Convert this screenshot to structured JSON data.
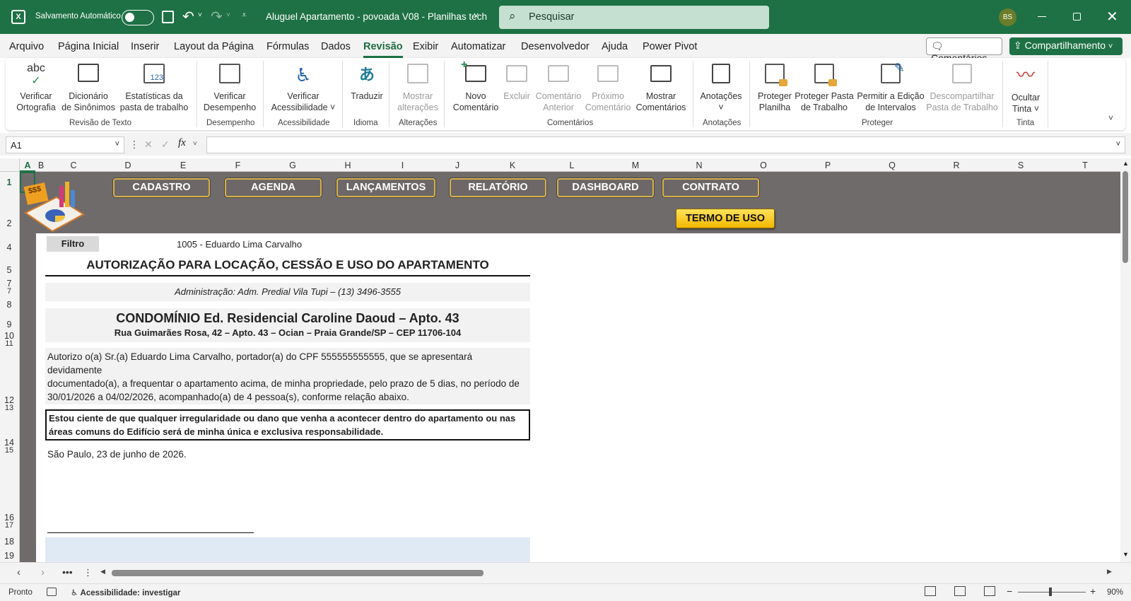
{
  "titlebar": {
    "autosave_label": "Salvamento Automático",
    "file_title": "Aluguel Apartamento - povoada V08 - Planilhas tech",
    "search_placeholder": "Pesquisar",
    "user_initials": "BS"
  },
  "menu": [
    "Arquivo",
    "Página Inicial",
    "Inserir",
    "Layout da Página",
    "Fórmulas",
    "Dados",
    "Revisão",
    "Exibir",
    "Automatizar",
    "Desenvolvedor",
    "Ajuda",
    "Power Pivot"
  ],
  "menu_active": "Revisão",
  "header_buttons": {
    "comments": "Comentários",
    "share": "Compartilhamento"
  },
  "ribbon": {
    "buttons": [
      {
        "l1": "Verificar",
        "l2": "Ortografia",
        "icon": "spelling-icon"
      },
      {
        "l1": "Dicionário",
        "l2": "de Sinônimos",
        "icon": "thesaurus-icon"
      },
      {
        "l1": "Estatísticas da",
        "l2": "pasta de trabalho",
        "icon": "workbook-stats-icon"
      },
      {
        "l1": "Verificar",
        "l2": "Desempenho",
        "icon": "performance-icon"
      },
      {
        "l1": "Verificar",
        "l2": "Acessibilidade ˅",
        "icon": "accessibility-icon"
      },
      {
        "l1": "Traduzir",
        "l2": "",
        "icon": "translate-icon"
      },
      {
        "l1": "Mostrar",
        "l2": "alterações",
        "icon": "show-changes-icon"
      },
      {
        "l1": "Novo",
        "l2": "Comentário",
        "icon": "new-comment-icon"
      },
      {
        "l1": "Excluir",
        "l2": "",
        "icon": "delete-comment-icon"
      },
      {
        "l1": "Comentário",
        "l2": "Anterior",
        "icon": "previous-comment-icon"
      },
      {
        "l1": "Próximo",
        "l2": "Comentário",
        "icon": "next-comment-icon"
      },
      {
        "l1": "Mostrar",
        "l2": "Comentários",
        "icon": "show-comments-icon"
      },
      {
        "l1": "Anotações",
        "l2": "˅",
        "icon": "notes-icon"
      },
      {
        "l1": "Proteger",
        "l2": "Planilha",
        "icon": "protect-sheet-icon"
      },
      {
        "l1": "Proteger Pasta",
        "l2": "de Trabalho",
        "icon": "protect-workbook-icon"
      },
      {
        "l1": "Permitir a Edição",
        "l2": "de Intervalos",
        "icon": "allow-edit-ranges-icon"
      },
      {
        "l1": "Descompartilhar",
        "l2": "Pasta de Trabalho",
        "icon": "unshare-workbook-icon"
      },
      {
        "l1": "Ocultar",
        "l2": "Tinta ˅",
        "icon": "hide-ink-icon"
      }
    ],
    "groups": [
      "Revisão de Texto",
      "Desempenho",
      "Acessibilidade",
      "Idioma",
      "Alterações",
      "Comentários",
      "Anotações",
      "Proteger",
      "Tinta"
    ]
  },
  "formula_bar": {
    "name_box": "A1",
    "fx": "fx"
  },
  "columns": [
    "A",
    "B",
    "C",
    "D",
    "E",
    "F",
    "G",
    "H",
    "I",
    "J",
    "K",
    "L",
    "M",
    "N",
    "O",
    "P",
    "Q",
    "R",
    "S",
    "T"
  ],
  "rows": [
    "1",
    "2",
    "4",
    "5",
    "7",
    "8",
    "9",
    "10",
    "11",
    "12",
    "13",
    "14",
    "15",
    "16",
    "17",
    "18",
    "19"
  ],
  "nav": {
    "buttons": [
      "CADASTRO",
      "AGENDA",
      "LANÇAMENTOS",
      "RELATÓRIO",
      "DASHBOARD",
      "CONTRATO"
    ],
    "termo": "TERMO DE USO",
    "logo_text": "$$$"
  },
  "doc": {
    "filtro_label": "Filtro",
    "filtro_value": "1005 - Eduardo Lima Carvalho",
    "title": "AUTORIZAÇÃO PARA LOCAÇÃO, CESSÃO E USO DO APARTAMENTO",
    "admin": "Administração: Adm. Predial Vila Tupi – (13) 3496-3555",
    "condo": "CONDOMÍNIO Ed. Residencial Caroline Daoud – Apto. 43",
    "address": "Rua Guimarães Rosa, 42 – Apto. 43 – Ocian – Praia Grande/SP – CEP 11706-104",
    "body_l1": "Autorizo o(a) Sr.(a) Eduardo Lima Carvalho, portador(a) do CPF 555555555555, que se apresentará devidamente",
    "body_l2": "documentado(a), a frequentar o apartamento acima, de minha propriedade, pelo prazo de 5 dias, no período de",
    "body_l3": "30/01/2026 a 04/02/2026, acompanhado(a) de 4 pessoa(s), conforme relação abaixo.",
    "notice_l1": "Estou ciente de que qualquer irregularidade ou dano que venha a acontecer dentro do apartamento ou nas",
    "notice_l2": "áreas comuns do Edifício será de minha única e exclusiva responsabilidade.",
    "date": "São Paulo, 23 de junho de 2026."
  },
  "status": {
    "ready": "Pronto",
    "accessibility": "Acessibilidade: investigar",
    "zoom": "90%"
  }
}
